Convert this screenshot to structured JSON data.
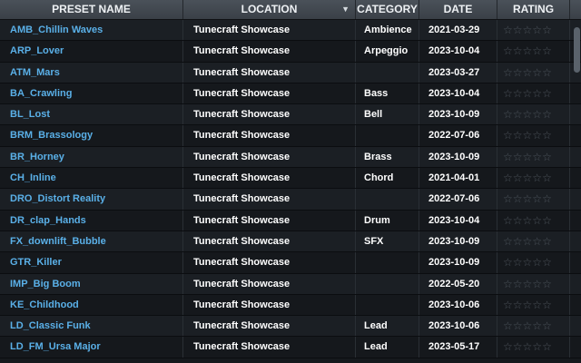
{
  "columns": {
    "name": "PRESET NAME",
    "location": "LOCATION",
    "category": "CATEGORY",
    "date": "DATE",
    "rating": "RATING"
  },
  "sort_icon": "chevron-down-icon",
  "rows": [
    {
      "name": "AMB_Chillin Waves",
      "location": "Tunecraft Showcase",
      "category": "Ambience",
      "date": "2021-03-29",
      "rating": 0
    },
    {
      "name": "ARP_Lover",
      "location": "Tunecraft Showcase",
      "category": "Arpeggio",
      "date": "2023-10-04",
      "rating": 0
    },
    {
      "name": "ATM_Mars",
      "location": "Tunecraft Showcase",
      "category": "",
      "date": "2023-03-27",
      "rating": 0
    },
    {
      "name": "BA_Crawling",
      "location": "Tunecraft Showcase",
      "category": "Bass",
      "date": "2023-10-04",
      "rating": 0
    },
    {
      "name": "BL_Lost",
      "location": "Tunecraft Showcase",
      "category": "Bell",
      "date": "2023-10-09",
      "rating": 0
    },
    {
      "name": "BRM_Brassology",
      "location": "Tunecraft Showcase",
      "category": "",
      "date": "2022-07-06",
      "rating": 0
    },
    {
      "name": "BR_Horney",
      "location": "Tunecraft Showcase",
      "category": "Brass",
      "date": "2023-10-09",
      "rating": 0
    },
    {
      "name": "CH_Inline",
      "location": "Tunecraft Showcase",
      "category": "Chord",
      "date": "2021-04-01",
      "rating": 0
    },
    {
      "name": "DRO_Distort Reality",
      "location": "Tunecraft Showcase",
      "category": "",
      "date": "2022-07-06",
      "rating": 0
    },
    {
      "name": "DR_clap_Hands",
      "location": "Tunecraft Showcase",
      "category": "Drum",
      "date": "2023-10-04",
      "rating": 0
    },
    {
      "name": "FX_downlift_Bubble",
      "location": "Tunecraft Showcase",
      "category": "SFX",
      "date": "2023-10-09",
      "rating": 0
    },
    {
      "name": "GTR_Killer",
      "location": "Tunecraft Showcase",
      "category": "",
      "date": "2023-10-09",
      "rating": 0
    },
    {
      "name": "IMP_Big Boom",
      "location": "Tunecraft Showcase",
      "category": "",
      "date": "2022-05-20",
      "rating": 0
    },
    {
      "name": "KE_Childhood",
      "location": "Tunecraft Showcase",
      "category": "",
      "date": "2023-10-06",
      "rating": 0
    },
    {
      "name": "LD_Classic Funk",
      "location": "Tunecraft Showcase",
      "category": "Lead",
      "date": "2023-10-06",
      "rating": 0
    },
    {
      "name": "LD_FM_Ursa Major",
      "location": "Tunecraft Showcase",
      "category": "Lead",
      "date": "2023-05-17",
      "rating": 0
    }
  ],
  "rating_max": 5,
  "colors": {
    "name_text": "#5ab0e8",
    "row_odd": "#1b1f24",
    "row_even": "#15181c",
    "header_bg": "#42484f",
    "star_empty": "#4f565e"
  }
}
